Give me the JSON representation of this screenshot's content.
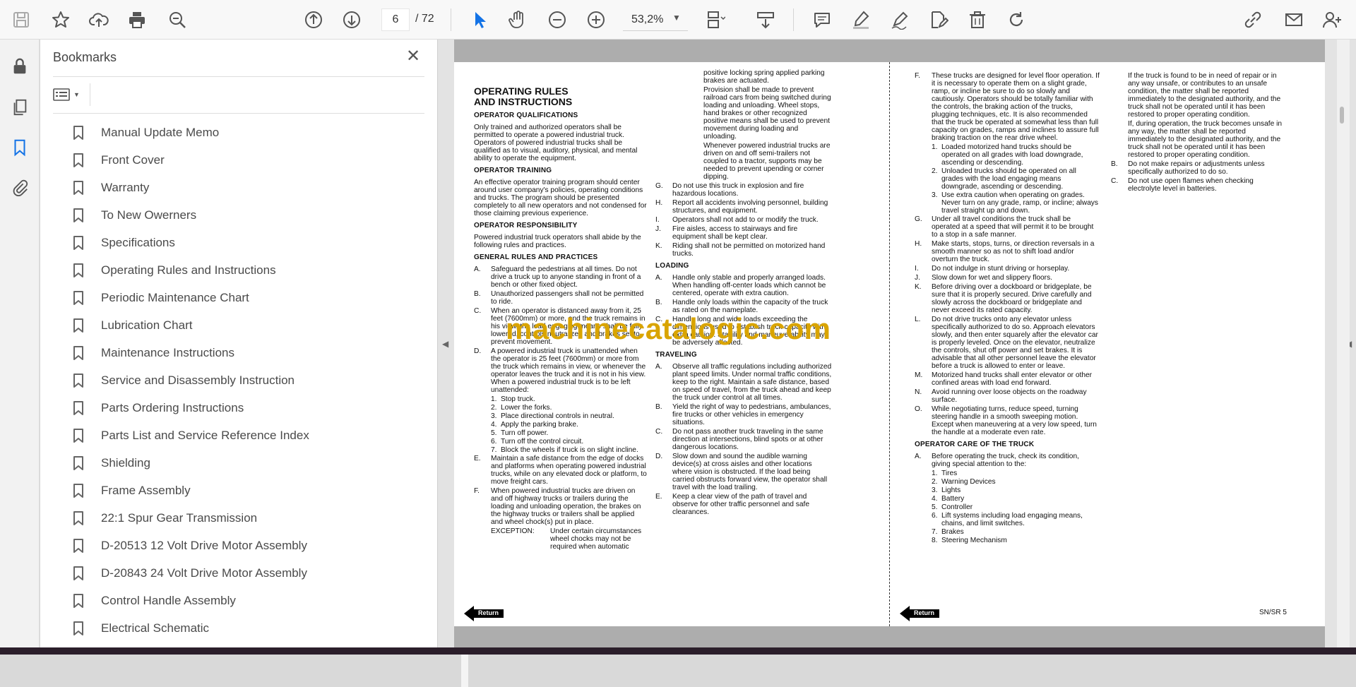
{
  "toolbar": {
    "page_current": "6",
    "page_total": "/ 72",
    "zoom": "53,2%"
  },
  "bookmarks_panel": {
    "title": "Bookmarks",
    "close_glyph": "✕",
    "items": [
      {
        "label": "Manual Update Memo"
      },
      {
        "label": "Front Cover"
      },
      {
        "label": "Warranty"
      },
      {
        "label": "To New Owerners"
      },
      {
        "label": "Specifications"
      },
      {
        "label": "Operating Rules and Instructions"
      },
      {
        "label": "Periodic Maintenance Chart"
      },
      {
        "label": "Lubrication Chart"
      },
      {
        "label": "Maintenance Instructions"
      },
      {
        "label": "Service and Disassembly Instruction"
      },
      {
        "label": "Parts Ordering Instructions"
      },
      {
        "label": "Parts List and Service Reference Index"
      },
      {
        "label": "Shielding"
      },
      {
        "label": "Frame Assembly"
      },
      {
        "label": "22:1 Spur Gear Transmission"
      },
      {
        "label": "D-20513 12 Volt Drive Motor Assembly"
      },
      {
        "label": "D-20843 24 Volt Drive Motor Assembly"
      },
      {
        "label": "Control Handle Assembly"
      },
      {
        "label": "Electrical Schematic"
      }
    ]
  },
  "document": {
    "watermark": "machinecatalogic.com",
    "left_page": {
      "title_line1": "OPERATING RULES",
      "title_line2": "AND INSTRUCTIONS",
      "h_qual": "OPERATOR QUALIFICATIONS",
      "p_qual": "Only trained and authorized operators shall be permitted to operate a powered industrial truck. Operators of powered industrial trucks shall be qualified as to visual, auditory, physical, and mental ability to operate the equipment.",
      "h_train": "OPERATOR TRAINING",
      "p_train": "An effective operator training program should center around user company's policies, operating conditions and trucks. The program should be presented completely to all new operators and not condensed for those claiming previous experience.",
      "h_resp": "OPERATOR RESPONSIBILITY",
      "p_resp": "Powered industrial truck operators shall abide by the following rules and practices.",
      "h_gen": "GENERAL RULES AND PRACTICES",
      "gA": "Safeguard the pedestrians at all times. Do not drive a truck up to anyone standing in front of a bench or other fixed object.",
      "gB": "Unauthorized passengers shall not be permitted to ride.",
      "gC": "When an operator is distanced away from it, 25 feet (7600mm) or more, and the truck remains in his view, the load engaging means shall be fully lowered, controls neutralized and brakes set to prevent movement.",
      "gD": "A powered industrial truck is unattended when the operator is 25 feet (7600mm) or more from the truck which remains in view, or whenever the operator leaves the truck and it is not in his view.",
      "gD2": "When a powered industrial truck is to be left unattended:",
      "d1": "Stop truck.",
      "d2": "Lower the forks.",
      "d3": "Place directional controls in neutral.",
      "d4": "Apply the parking brake.",
      "d5": "Turn off power.",
      "d6": "Turn off the control circuit.",
      "d7": "Block the wheels if truck is on slight incline.",
      "gE": "Maintain a safe distance from the edge of docks and platforms when operating powered industrial trucks, while on any elevated dock or platform, to move freight cars.",
      "gF": "When powered industrial trucks are driven on and off highway trucks or trailers during the loading and unloading operation, the brakes on the highway trucks or trailers shall be applied and wheel chock(s) put in place.",
      "exc_label": "EXCEPTION:",
      "exc_text": "Under certain circumstances wheel chocks may not be required when automatic",
      "c2_top": "positive locking spring applied parking brakes are actuated.",
      "c2_prov": "Provision shall be made to prevent railroad cars from being switched during loading and unloading. Wheel stops, hand brakes or other recognized positive means shall be used to prevent movement during loading and unloading.",
      "c2_when": "Whenever powered industrial trucks are driven on and off semi-trailers not coupled to a tractor, supports may be needed to prevent upending or corner dipping.",
      "gG": "Do not use this truck in explosion and fire hazardous locations.",
      "gH": "Report all accidents involving personnel, building structures, and equipment.",
      "gI": "Operators shall not add to or modify the truck.",
      "gJ": "Fire aisles, access to stairways and fire equipment shall be kept clear.",
      "gK": "Riding shall not be permitted on motorized hand trucks.",
      "h_load": "LOADING",
      "lA": "Handle only stable and properly arranged loads. When handling off-center loads which cannot be centered, operate with extra caution.",
      "lB": "Handle only loads within the capacity of the truck as rated on the nameplate.",
      "lC": "Handle long and wide loads exceeding the dimensions used to establish truck capacity with extra caution. Stability and maneuverability may be adversely affected.",
      "h_trav": "TRAVELING",
      "tA": "Observe all traffic regulations including authorized plant speed limits. Under normal traffic conditions, keep to the right. Maintain a safe distance, based on speed of travel, from the truck ahead and keep the truck under control at all times.",
      "tB": "Yield the right of way to pedestrians, ambulances, fire trucks or other vehicles in emergency situations.",
      "tC": "Do not pass another truck traveling in the same direction at intersections, blind spots or at other dangerous locations.",
      "tD": "Slow down and sound the audible warning device(s) at cross aisles and other locations where vision is obstructed. If the load being carried obstructs forward view, the operator shall travel with the load trailing.",
      "tE": "Keep a clear view of the path of travel and observe for other traffic personnel and safe clearances.",
      "return_label": "Return"
    },
    "right_page": {
      "rF": "These trucks are designed for level floor operation. If it is necessary to operate them on a slight grade, ramp, or incline be sure to do so slowly and cautiously. Operators should be totally familiar with the controls, the braking action of the trucks, plugging techniques, etc. It is also recommended that the truck be operated at somewhat less than full capacity on grades, ramps and inclines to assure full braking traction on the rear drive wheel.",
      "f1": "Loaded motorized hand trucks should be operated on all grades with load downgrade, ascending or descending.",
      "f2": "Unloaded trucks should be operated on all grades with the load engaging means downgrade, ascending or descending.",
      "f3": "Use extra caution when operating on grades. Never turn on any grade, ramp, or incline; always travel straight up and down.",
      "rG": "Under all travel conditions the truck shall be operated at a speed that will permit it to be brought to a stop in a safe manner.",
      "rH": "Make starts, stops, turns, or direction reversals in a smooth manner so as not to shift load and/or overturn the truck.",
      "rI": "Do not indulge in stunt driving or horseplay.",
      "rJ": "Slow down for wet and slippery floors.",
      "rK": "Before driving over a dockboard or bridgeplate, be sure that it is properly secured. Drive carefully and slowly across the dockboard or bridgeplate and never exceed its rated capacity.",
      "rL": "Do not drive trucks onto any elevator unless specifically authorized to do so. Approach elevators slowly, and then enter squarely after the elevator car is properly leveled. Once on the elevator, neutralize the controls, shut off power and set brakes. It is advisable that all other personnel leave the elevator before a truck is allowed to enter or leave.",
      "rM": "Motorized hand trucks shall enter elevator or other confined areas with load end forward.",
      "rN": "Avoid running over loose objects on the roadway surface.",
      "rO": "While negotiating turns, reduce speed, turning steering handle in a smooth sweeping motion. Except when maneuvering at a very low speed, turn the handle at a moderate even rate.",
      "h_care": "OPERATOR CARE OF THE TRUCK",
      "cA": "Before operating the truck, check its condition, giving special attention to the:",
      "c1": "Tires",
      "c2": "Warning Devices",
      "c3": "Lights",
      "c4": "Battery",
      "c5": "Controller",
      "c6": "Lift systems including load engaging means, chains, and limit switches.",
      "c7": "Brakes",
      "c8": "Steering Mechanism",
      "r2_a": "If the truck is found to be in need of repair or in any way unsafe, or contributes to an unsafe condition, the matter shall be reported immediately to the designated authority, and the truck shall not be operated until it has been restored to proper operating condition.",
      "r2_b": "If, during operation, the truck becomes unsafe in any way, the matter shall be reported immediately to the designated authority, and the truck shall not be operated until it has been restored to proper operating condition.",
      "rB": "Do not make repairs or adjustments unless specifically authorized to do so.",
      "rC": "Do not use open flames when checking electrolyte level in batteries.",
      "return_label": "Return",
      "page_ref": "SN/SR 5"
    }
  }
}
